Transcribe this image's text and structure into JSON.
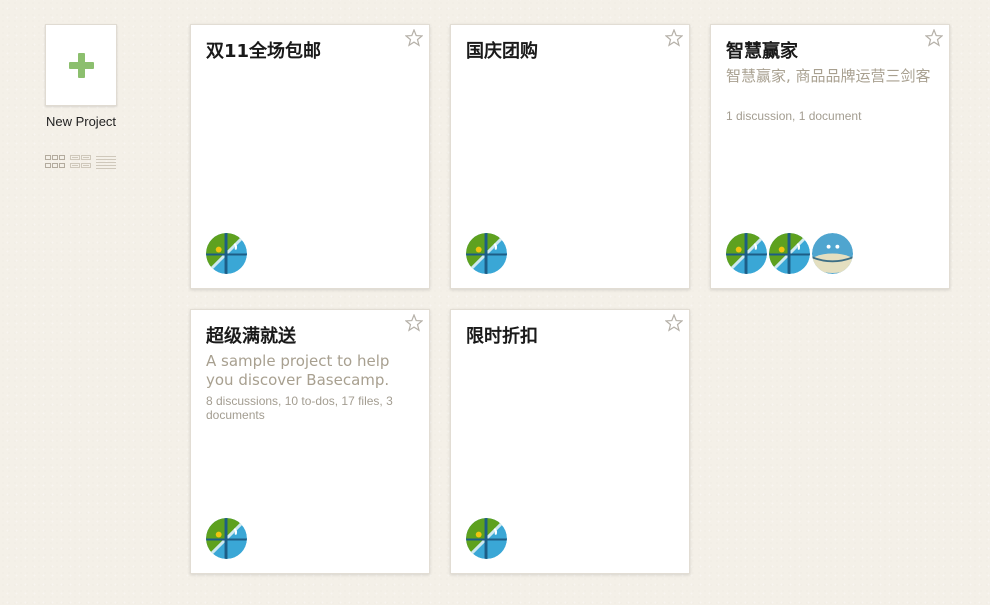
{
  "sidebar": {
    "new_project_label": "New Project",
    "plus_color": "#8cbf6e",
    "view_icons": [
      "grid-view-icon",
      "compact-view-icon",
      "list-view-icon"
    ]
  },
  "projects": [
    {
      "title": "双11全场包邮",
      "description": "",
      "meta": "",
      "avatars": [
        "globe-avatar"
      ]
    },
    {
      "title": "国庆团购",
      "description": "",
      "meta": "",
      "avatars": [
        "globe-avatar"
      ]
    },
    {
      "title": "智慧赢家",
      "description": "智慧赢家, 商品品牌运营三剑客",
      "meta": "1 discussion, 1 document",
      "avatars": [
        "globe-avatar",
        "globe-avatar",
        "blue-blob-avatar"
      ]
    },
    {
      "title": "超级满就送",
      "description": "A sample project to help you discover Basecamp.",
      "meta": "8 discussions, 10 to-dos, 17 files, 3 documents",
      "avatars": [
        "globe-avatar"
      ]
    },
    {
      "title": "限时折扣",
      "description": "",
      "meta": "",
      "avatars": [
        "globe-avatar"
      ]
    }
  ]
}
